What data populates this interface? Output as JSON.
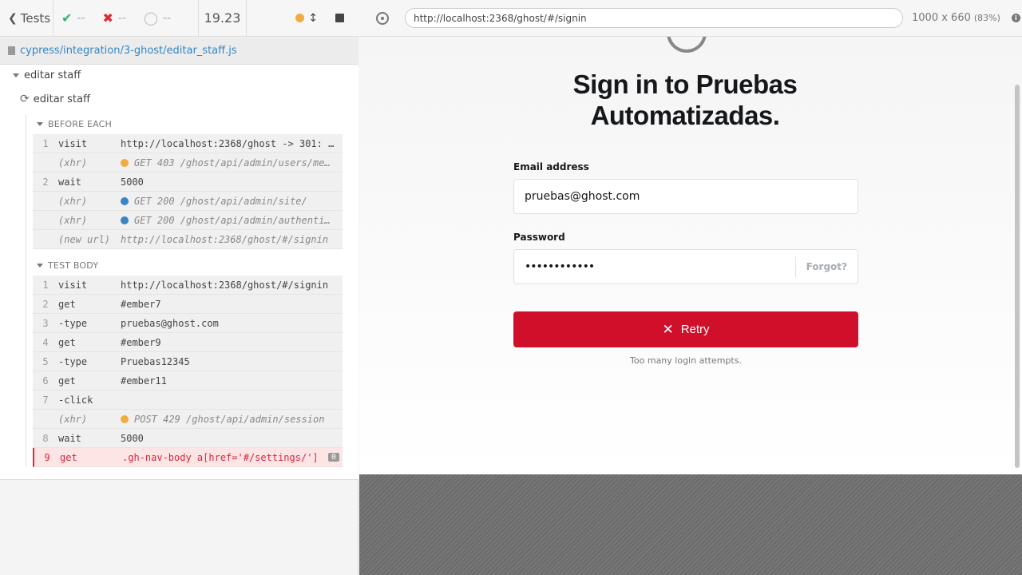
{
  "runner": {
    "tests_label": "Tests",
    "passed": "--",
    "failed": "--",
    "pending": "--",
    "duration": "19.23"
  },
  "spec_path": "cypress/integration/3-ghost/editar_staff.js",
  "tree": {
    "suite": "editar staff",
    "test": "editar staff",
    "before_each_title": "BEFORE EACH",
    "test_body_title": "TEST BODY",
    "before_each": [
      {
        "num": "1",
        "name": "visit",
        "msg": "http://localhost:2368/ghost -> 301: …",
        "xhr": false
      },
      {
        "num": "",
        "name": "(xhr)",
        "msg": "GET 403 /ghost/api/admin/users/me…",
        "xhr": true,
        "dot": "#f0ac3f"
      },
      {
        "num": "2",
        "name": "wait",
        "msg": "5000",
        "xhr": false
      },
      {
        "num": "",
        "name": "(xhr)",
        "msg": "GET 200 /ghost/api/admin/site/",
        "xhr": true,
        "dot": "#3b84c5"
      },
      {
        "num": "",
        "name": "(xhr)",
        "msg": "GET 200 /ghost/api/admin/authenti…",
        "xhr": true,
        "dot": "#3b84c5"
      },
      {
        "num": "",
        "name": "(new url)",
        "msg": "http://localhost:2368/ghost/#/signin",
        "xhr": true
      }
    ],
    "test_body": [
      {
        "num": "1",
        "name": "visit",
        "msg": "http://localhost:2368/ghost/#/signin"
      },
      {
        "num": "2",
        "name": "get",
        "msg": "#ember7"
      },
      {
        "num": "3",
        "name": " -type",
        "msg": "pruebas@ghost.com"
      },
      {
        "num": "4",
        "name": "get",
        "msg": "#ember9"
      },
      {
        "num": "5",
        "name": " -type",
        "msg": "Pruebas12345"
      },
      {
        "num": "6",
        "name": "get",
        "msg": "#ember11"
      },
      {
        "num": "7",
        "name": " -click",
        "msg": ""
      },
      {
        "num": "",
        "name": "(xhr)",
        "msg": "POST 429 /ghost/api/admin/session",
        "xhr": true,
        "dot": "#f0ac3f"
      },
      {
        "num": "8",
        "name": "wait",
        "msg": "5000"
      },
      {
        "num": "9",
        "name": "get",
        "msg": ".gh-nav-body a[href='#/settings/']",
        "error": true,
        "badge": "0"
      }
    ]
  },
  "browser": {
    "url": "http://localhost:2368/ghost/#/signin",
    "viewport": "1000 x 660",
    "scale": "(83%)"
  },
  "signin": {
    "title_line1": "Sign in to Pruebas",
    "title_line2": "Automatizadas.",
    "email_label": "Email address",
    "email_value": "pruebas@ghost.com",
    "password_label": "Password",
    "password_value": "••••••••••••",
    "forgot_label": "Forgot?",
    "retry_label": "Retry",
    "note": "Too many login attempts."
  },
  "colors": {
    "retry_button": "#d0102a",
    "xhr_orange": "#f0ac3f",
    "xhr_blue": "#3b84c5",
    "error_red": "#d6283a"
  }
}
